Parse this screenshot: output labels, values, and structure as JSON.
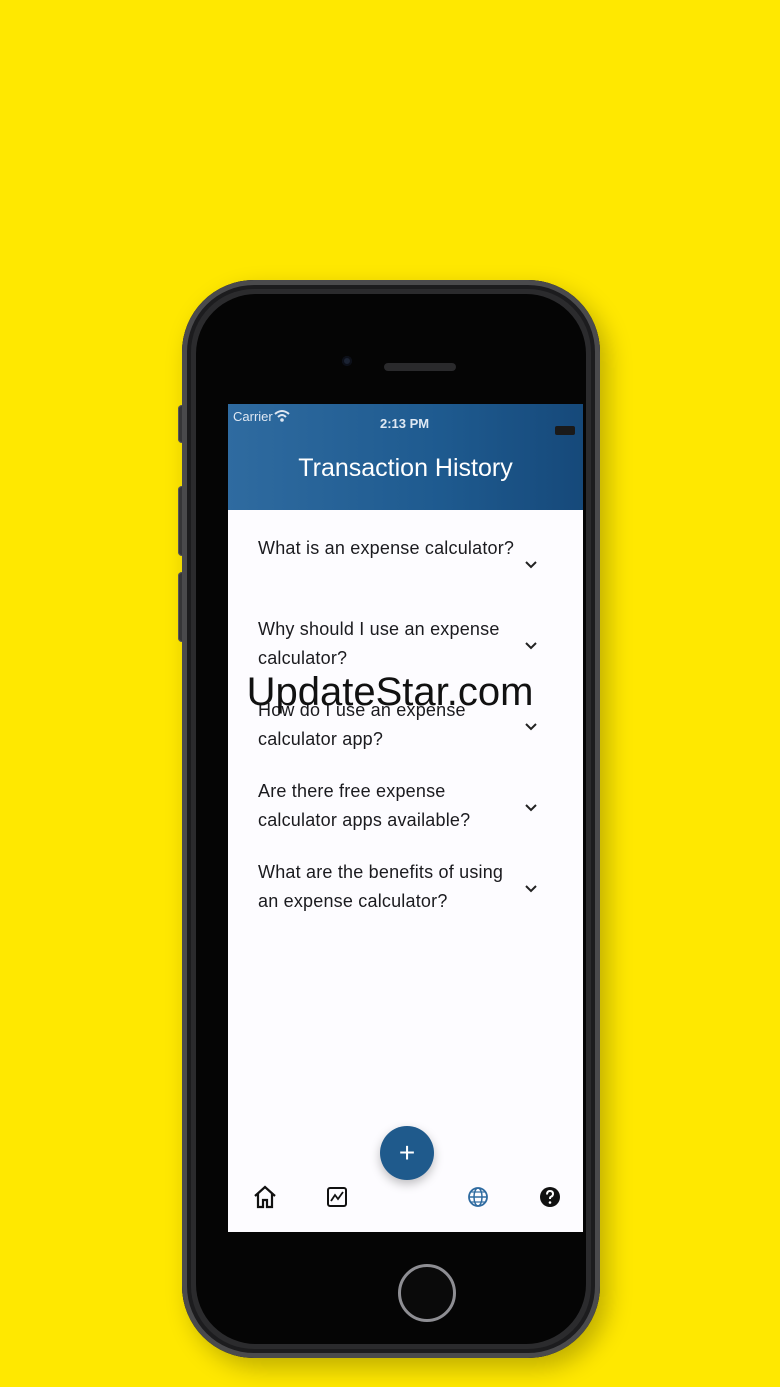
{
  "status_bar": {
    "carrier": "Carrier",
    "time": "2:13 PM"
  },
  "header": {
    "title": "Transaction History",
    "gradient": [
      "#2F6BA0",
      "#16497A"
    ]
  },
  "faq": {
    "items": [
      {
        "question": "What is an expense calculator?"
      },
      {
        "question": "Why should I use an expense calculator?"
      },
      {
        "question": "How do I use an expense calculator app?"
      },
      {
        "question": "Are there free expense calculator apps available?"
      },
      {
        "question": "What are the benefits of using an expense calculator?"
      }
    ],
    "expand_icon": "chevron-down-icon"
  },
  "watermark": "UpdateStar.com",
  "tab_bar": {
    "fab_label": "+",
    "tabs": [
      {
        "icon": "home-icon"
      },
      {
        "icon": "chart-icon"
      },
      {
        "icon": "globe-icon"
      },
      {
        "icon": "help-icon"
      }
    ],
    "fab_color": "#1F5A8C",
    "active_color": "#2F6BA0"
  },
  "background_color": "#FFE800"
}
